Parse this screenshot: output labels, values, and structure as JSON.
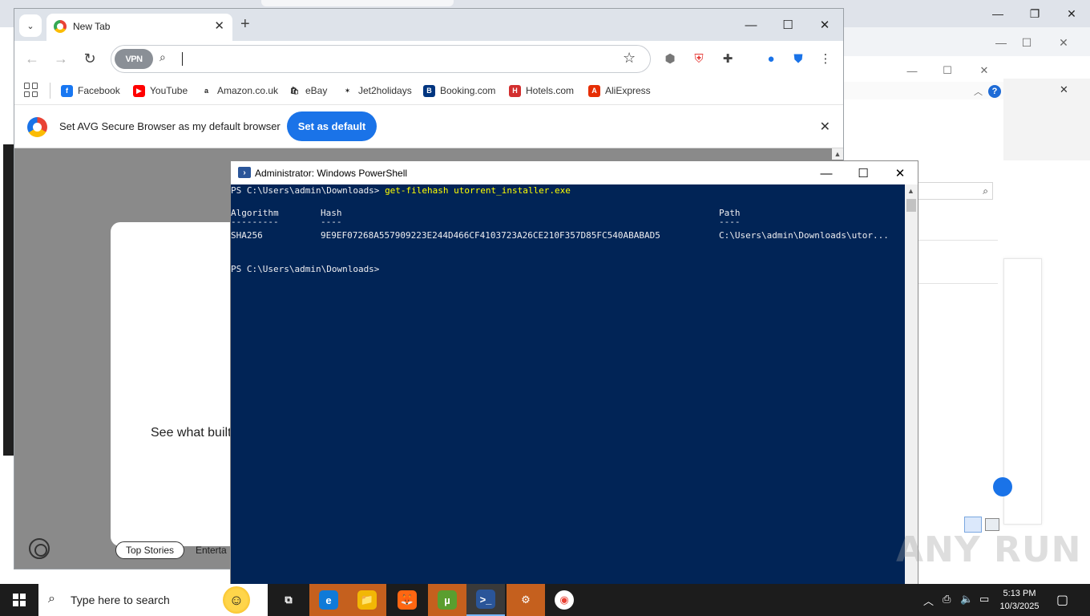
{
  "background_window": {
    "icons": {
      "minimize": "minimize-icon",
      "restore": "restore-icon",
      "close": "close-icon"
    }
  },
  "browser": {
    "tab": {
      "title": "New Tab"
    },
    "omnibox": {
      "vpn_label": "VPN",
      "value": ""
    },
    "bookmarks": [
      {
        "label": "Facebook",
        "icon": "facebook-icon",
        "color": "#1877f2",
        "glyph": "f"
      },
      {
        "label": "YouTube",
        "icon": "youtube-icon",
        "color": "#ff0000",
        "glyph": "▶"
      },
      {
        "label": "Amazon.co.uk",
        "icon": "amazon-icon",
        "color": "#ffffff",
        "glyph": "a"
      },
      {
        "label": "eBay",
        "icon": "ebay-icon",
        "color": "#ffffff",
        "glyph": "🛍"
      },
      {
        "label": "Jet2holidays",
        "icon": "jet2-icon",
        "color": "#ffffff",
        "glyph": "✶"
      },
      {
        "label": "Booking.com",
        "icon": "booking-icon",
        "color": "#003580",
        "glyph": "B"
      },
      {
        "label": "Hotels.com",
        "icon": "hotels-icon",
        "color": "#d32f2f",
        "glyph": "H"
      },
      {
        "label": "AliExpress",
        "icon": "aliexpress-icon",
        "color": "#e62e04",
        "glyph": "A"
      }
    ],
    "infobar": {
      "message": "Set AVG Secure Browser as my default browser",
      "button": "Set as default"
    },
    "content": {
      "card_text": "See what built",
      "pills": [
        "Top Stories",
        "Enterta"
      ]
    }
  },
  "powershell": {
    "title": "Administrator: Windows PowerShell",
    "prompt": "PS C:\\Users\\admin\\Downloads>",
    "command": "get-filehash utorrent_installer.exe",
    "table": {
      "headers": [
        "Algorithm",
        "Hash",
        "Path"
      ],
      "underline": [
        "---------",
        "----",
        "----"
      ],
      "row": [
        "SHA256",
        "9E9EF07268A557909223E244D466CF4103723A26CE210F357D85FC540ABABAD5",
        "C:\\Users\\admin\\Downloads\\utor..."
      ]
    },
    "prompt2": "PS C:\\Users\\admin\\Downloads>"
  },
  "watermark": "ANY RUN",
  "taskbar": {
    "search_placeholder": "Type here to search",
    "apps": [
      {
        "name": "task-view",
        "glyph": "⧉",
        "color": "#1c1c1c"
      },
      {
        "name": "edge",
        "glyph": "e",
        "color": "#0f7ad8"
      },
      {
        "name": "file-explorer",
        "glyph": "📁",
        "color": "#f2b705"
      },
      {
        "name": "firefox",
        "glyph": "🦊",
        "color": "#ff6611"
      },
      {
        "name": "utorrent",
        "glyph": "µ",
        "color": "#5a9e2f"
      },
      {
        "name": "powershell",
        "glyph": ">_",
        "color": "#2a5599"
      },
      {
        "name": "settings",
        "glyph": "⚙",
        "color": "#c5601e"
      },
      {
        "name": "avg-browser",
        "glyph": "◉",
        "color": "#ffffff"
      }
    ],
    "time": "5:13 PM",
    "date": "10/3/2025"
  }
}
